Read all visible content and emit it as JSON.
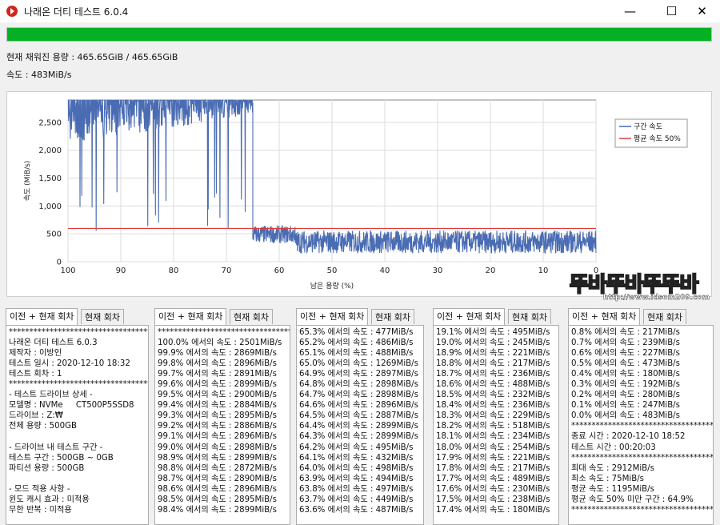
{
  "window": {
    "title": "나래온 더티 테스트 6.0.4",
    "minimize": "—",
    "maximize": "☐",
    "close": "✕"
  },
  "status": {
    "progress_percent": 100,
    "progress_color": "#06b025",
    "filled_text": "현재 채워진 용량 : 465.65GiB / 465.65GiB",
    "speed_text": "속도 : 483MiB/s"
  },
  "chart_data": {
    "type": "line",
    "xlabel": "남은 용량 (%)",
    "ylabel": "속도 (MiB/s)",
    "xlim": [
      100,
      0
    ],
    "ylim": [
      0,
      2900
    ],
    "x_ticks": [
      "100",
      "90",
      "80",
      "70",
      "60",
      "50",
      "40",
      "30",
      "20",
      "10",
      "0"
    ],
    "y_ticks": [
      "0",
      "500",
      "1,000",
      "1,500",
      "2,000",
      "2,500"
    ],
    "grid": true,
    "legend_position": "top-right",
    "series": [
      {
        "name": "구간 속도",
        "color": "#4a6cb3",
        "segments": [
          {
            "from": 100,
            "to": 65,
            "low": 2100,
            "high": 2900,
            "dips_to": 550
          },
          {
            "from": 65,
            "to": 57,
            "low": 330,
            "high": 650
          },
          {
            "from": 57,
            "to": 0,
            "low": 150,
            "high": 560
          }
        ]
      },
      {
        "name": "평균 속도 50%",
        "color": "#e03a3a",
        "value": 597
      }
    ]
  },
  "tabs": {
    "combined": "이전 + 현재 회차",
    "current": "현재 회차"
  },
  "logs": [
    [
      "************************************************",
      "나래온 더티 테스트 6.0.3",
      "제작자 : 이방인",
      "테스트 일시 : 2020-12-10 18:32",
      "테스트 회차 : 1",
      "************************************************",
      "- 테스트 드라이브 상세 -",
      "모델명 : NVMe     CT500P5SSD8",
      "드라이브 : Z:₩",
      "전체 용량 : 500GB",
      "",
      "- 드라이브 내 테스트 구간 -",
      "테스트 구간 : 500GB ~ 0GB",
      "파티션 용량 : 500GB",
      "",
      "- 모드 적용 사항 -",
      "윈도 캐시 효과 : 미적용",
      "무한 반복 : 미적용"
    ],
    [
      "************************************************",
      "100.0% 에서의 속도 : 2501MiB/s",
      "99.9% 에서의 속도 : 2869MiB/s",
      "99.8% 에서의 속도 : 2896MiB/s",
      "99.7% 에서의 속도 : 2891MiB/s",
      "99.6% 에서의 속도 : 2899MiB/s",
      "99.5% 에서의 속도 : 2900MiB/s",
      "99.4% 에서의 속도 : 2884MiB/s",
      "99.3% 에서의 속도 : 2895MiB/s",
      "99.2% 에서의 속도 : 2886MiB/s",
      "99.1% 에서의 속도 : 2896MiB/s",
      "99.0% 에서의 속도 : 2898MiB/s",
      "98.9% 에서의 속도 : 2899MiB/s",
      "98.8% 에서의 속도 : 2872MiB/s",
      "98.7% 에서의 속도 : 2890MiB/s",
      "98.6% 에서의 속도 : 2896MiB/s",
      "98.5% 에서의 속도 : 2895MiB/s",
      "98.4% 에서의 속도 : 2899MiB/s"
    ],
    [
      "65.3% 에서의 속도 : 477MiB/s",
      "65.2% 에서의 속도 : 486MiB/s",
      "65.1% 에서의 속도 : 488MiB/s",
      "65.0% 에서의 속도 : 1269MiB/s",
      "64.9% 에서의 속도 : 2897MiB/s",
      "64.8% 에서의 속도 : 2898MiB/s",
      "64.7% 에서의 속도 : 2898MiB/s",
      "64.6% 에서의 속도 : 2896MiB/s",
      "64.5% 에서의 속도 : 2887MiB/s",
      "64.4% 에서의 속도 : 2899MiB/s",
      "64.3% 에서의 속도 : 2899MiB/s",
      "64.2% 에서의 속도 : 495MiB/s",
      "64.1% 에서의 속도 : 432MiB/s",
      "64.0% 에서의 속도 : 498MiB/s",
      "63.9% 에서의 속도 : 494MiB/s",
      "63.8% 에서의 속도 : 497MiB/s",
      "63.7% 에서의 속도 : 449MiB/s",
      "63.6% 에서의 속도 : 487MiB/s"
    ],
    [
      "19.1% 에서의 속도 : 495MiB/s",
      "19.0% 에서의 속도 : 245MiB/s",
      "18.9% 에서의 속도 : 221MiB/s",
      "18.8% 에서의 속도 : 217MiB/s",
      "18.7% 에서의 속도 : 236MiB/s",
      "18.6% 에서의 속도 : 488MiB/s",
      "18.5% 에서의 속도 : 232MiB/s",
      "18.4% 에서의 속도 : 236MiB/s",
      "18.3% 에서의 속도 : 229MiB/s",
      "18.2% 에서의 속도 : 518MiB/s",
      "18.1% 에서의 속도 : 234MiB/s",
      "18.0% 에서의 속도 : 254MiB/s",
      "17.9% 에서의 속도 : 221MiB/s",
      "17.8% 에서의 속도 : 217MiB/s",
      "17.7% 에서의 속도 : 489MiB/s",
      "17.6% 에서의 속도 : 230MiB/s",
      "17.5% 에서의 속도 : 238MiB/s",
      "17.4% 에서의 속도 : 180MiB/s"
    ],
    [
      "0.8% 에서의 속도 : 217MiB/s",
      "0.7% 에서의 속도 : 239MiB/s",
      "0.6% 에서의 속도 : 227MiB/s",
      "0.5% 에서의 속도 : 473MiB/s",
      "0.4% 에서의 속도 : 180MiB/s",
      "0.3% 에서의 속도 : 192MiB/s",
      "0.2% 에서의 속도 : 280MiB/s",
      "0.1% 에서의 속도 : 247MiB/s",
      "0.0% 에서의 속도 : 483MiB/s",
      "************************************************",
      "종료 시간 : 2020-12-10 18:52",
      "테스트 시간 : 00:20:03",
      "************************************************",
      "최대 속도 : 2912MiB/s",
      "최소 속도 : 75MiB/s",
      "평균 속도 : 1195MiB/s",
      "평균 속도 50% 미만 구간 : 64.9%",
      "************************************************"
    ]
  ],
  "watermark": {
    "big": "뚜바뚜바뚜뚜바",
    "small": "http://www.idsom209.com"
  }
}
